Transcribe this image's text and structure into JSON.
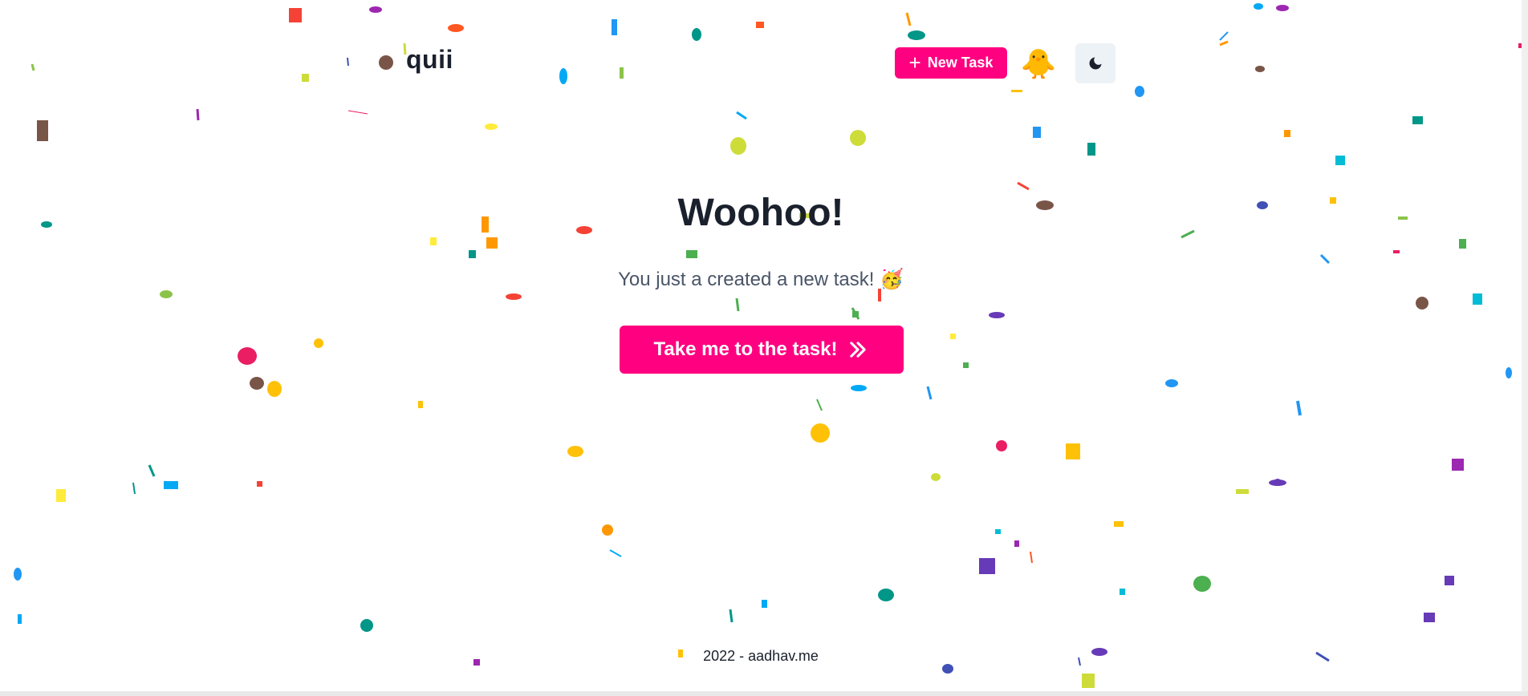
{
  "header": {
    "brand": "quii",
    "new_task_label": "New Task",
    "avatar_emoji": "🐥",
    "theme_icon": "moon-icon"
  },
  "main": {
    "title": "Woohoo!",
    "subtitle": "You just a created a new task! 🥳",
    "cta_label": "Take me to the task!",
    "cta_icon": "double-chevron-right-icon"
  },
  "footer": {
    "text": "2022 - aadhav.me"
  },
  "colors": {
    "accent": "#ff0080",
    "theme_button_bg": "#edf2f7",
    "heading": "#1a202c",
    "subtext": "#4a5568"
  }
}
